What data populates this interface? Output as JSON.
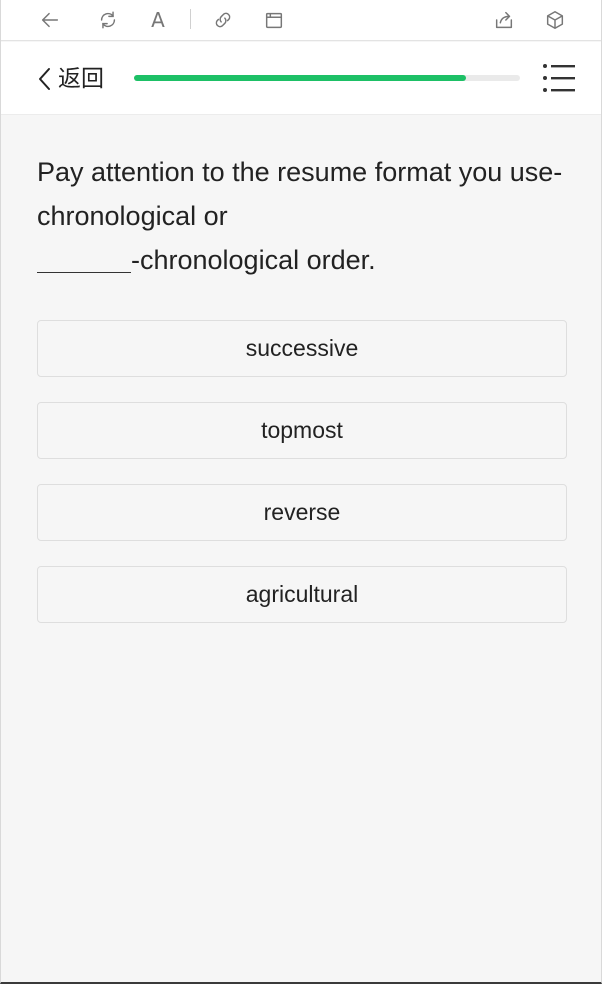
{
  "toolbar": {
    "icons": [
      "back-arrow-icon",
      "refresh-icon",
      "font-size-icon",
      "link-icon",
      "window-icon",
      "share-icon",
      "cube-icon"
    ],
    "font_glyph": "A"
  },
  "header": {
    "back_label": "返回",
    "progress_percent": 86,
    "colors": {
      "progress": "#1dc066",
      "track": "#eaeaea"
    }
  },
  "question": {
    "line1": "Pay attention to the resume format you use-chronological or",
    "line2_suffix": "-chronological order."
  },
  "options": [
    {
      "label": "successive"
    },
    {
      "label": "topmost"
    },
    {
      "label": "reverse"
    },
    {
      "label": "agricultural"
    }
  ]
}
